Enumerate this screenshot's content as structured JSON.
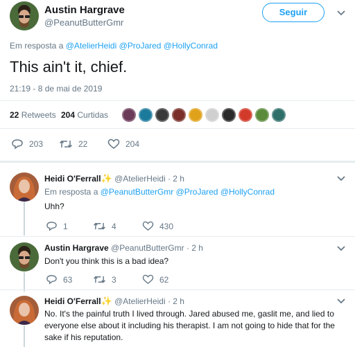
{
  "main_tweet": {
    "author_name": "Austin Hargrave",
    "author_handle": "@PeanutButterGmr",
    "follow_label": "Seguir",
    "reply_prefix": "Em resposta a",
    "reply_mentions": "@AtelierHeidi @ProJared @HollyConrad",
    "text": "This ain't it, chief.",
    "timestamp": "21:19 - 8 de mai de 2019",
    "retweets_count": "22",
    "retweets_label": "Retweets",
    "likes_count": "204",
    "likes_label": "Curtidas",
    "reply_count": "203",
    "retweet_count": "22",
    "like_count": "204"
  },
  "liker_colors": [
    "#6b3b5a",
    "#1c7a9c",
    "#3a3a3a",
    "#7a2f2a",
    "#e0a21a",
    "#cfcfcf",
    "#2a2a2a",
    "#d23a2a",
    "#5a8a3a",
    "#2f6f6a"
  ],
  "replies": [
    {
      "name": "Heidi O'Ferrall",
      "star": "✨",
      "handle": "@AtelierHeidi",
      "time": "· 2 h",
      "reply_prefix": "Em resposta a",
      "reply_mentions": "@PeanutButterGmr @ProJared @HollyConrad",
      "text": "Uhh?",
      "replies": "1",
      "retweets": "4",
      "likes": "430"
    },
    {
      "name": "Austin Hargrave",
      "handle": "@PeanutButterGmr",
      "time": "· 2 h",
      "text": "Don't you think this is a bad idea?",
      "replies": "63",
      "retweets": "3",
      "likes": "62"
    },
    {
      "name": "Heidi O'Ferrall",
      "star": "✨",
      "handle": "@AtelierHeidi",
      "time": "· 2 h",
      "text": "No. It's the painful truth I lived through. Jared abused me, gaslit me, and lied to everyone else about it including his therapist. I am not going to hide that for the sake if his reputation."
    }
  ]
}
